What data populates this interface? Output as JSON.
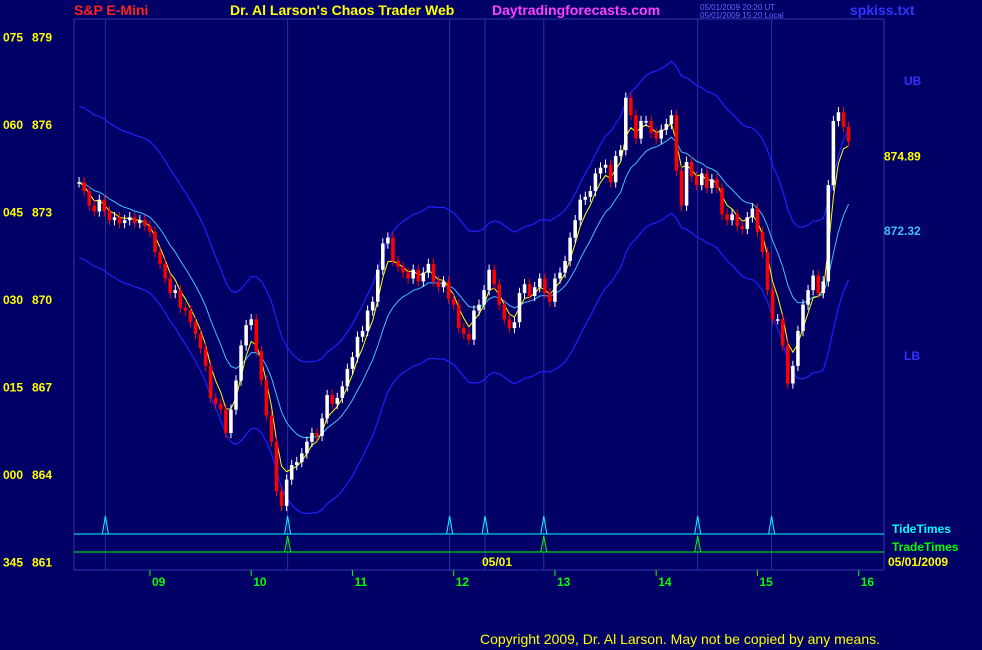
{
  "header": {
    "symbol": "S&P E-Mini",
    "title": "Dr. Al Larson's Chaos Trader Web",
    "site": "Daytradingforecasts.com",
    "stamp_ut": "05/01/2009 20:20 UT",
    "stamp_local": "05/01/2009 15:20 Local",
    "file": "spkiss.txt"
  },
  "labels": {
    "ub": "UB",
    "lb": "LB",
    "last_price": "874.89",
    "mid_price": "872.32",
    "tide_times": "TideTimes",
    "trade_times": "TradeTimes",
    "date_marker": "05/01",
    "date_right": "05/01/2009"
  },
  "copyright": "Copyright 2009, Dr. Al Larson. May not be copied by any means.",
  "colors": {
    "background": "#000066",
    "candle_up": "#ffffff",
    "candle_down": "#ff0000",
    "fast_ma": "#ffff00",
    "slow_ma": "#40c0ff",
    "bands": "#2020ff",
    "tide": "#00ffff",
    "trade": "#00ff00",
    "yaxis": "#ffff00",
    "xaxis": "#00ff00"
  },
  "chart_data": {
    "type": "candlestick",
    "y_ticks": [
      {
        "left": "075",
        "value": 879
      },
      {
        "left": "060",
        "value": 876
      },
      {
        "left": "045",
        "value": 873
      },
      {
        "left": "030",
        "value": 870
      },
      {
        "left": "015",
        "value": 867
      },
      {
        "left": "000",
        "value": 864
      },
      {
        "left": "345",
        "value": 861
      }
    ],
    "x_ticks": [
      "09",
      "10",
      "11",
      "12",
      "13",
      "14",
      "15",
      "16"
    ],
    "x_tick_times": [
      9,
      10,
      11,
      12,
      13,
      14,
      15,
      16
    ],
    "x_range": [
      8.25,
      16.25
    ],
    "ylim": [
      860.7,
      879.6
    ],
    "tide_times": [
      8.56,
      10.36,
      11.96,
      12.31,
      12.89,
      14.41,
      15.14
    ],
    "trade_times": [
      10.36,
      12.89,
      14.41
    ],
    "vlines": [
      8.56,
      10.36,
      11.96,
      12.31,
      12.89,
      14.41,
      15.14
    ],
    "last_price": 874.89,
    "mid_price": 872.32,
    "candles": {
      "start": 8.3,
      "step": 0.05,
      "closes": [
        874.0,
        873.7,
        873.2,
        873.0,
        873.4,
        873.0,
        872.7,
        872.8,
        872.6,
        872.7,
        872.8,
        872.6,
        872.7,
        872.5,
        872.3,
        871.6,
        871.2,
        870.7,
        870.2,
        870.3,
        869.7,
        869.6,
        869.2,
        868.8,
        868.3,
        867.7,
        866.6,
        866.4,
        866.2,
        865.4,
        866.2,
        867.2,
        868.4,
        869.1,
        869.3,
        868.2,
        867.2,
        866.0,
        865.1,
        863.4,
        862.9,
        863.8,
        864.3,
        864.4,
        864.7,
        865.1,
        865.4,
        865.3,
        865.9,
        866.7,
        866.4,
        866.6,
        867.0,
        867.6,
        868.0,
        868.7,
        868.9,
        869.6,
        869.9,
        871.0,
        871.9,
        872.1,
        871.3,
        871.1,
        870.9,
        870.7,
        871.0,
        870.6,
        870.9,
        871.2,
        870.6,
        870.4,
        870.6,
        870.0,
        869.8,
        869.0,
        868.8,
        868.6,
        869.6,
        869.8,
        870.3,
        871.0,
        870.5,
        869.8,
        869.3,
        869.0,
        869.2,
        870.2,
        870.5,
        870.1,
        870.4,
        870.7,
        870.2,
        869.9,
        870.7,
        870.9,
        871.3,
        872.1,
        872.7,
        873.4,
        873.5,
        873.7,
        874.3,
        874.5,
        874.6,
        874.0,
        874.9,
        875.1,
        876.9,
        876.3,
        875.5,
        876.1,
        876.1,
        875.7,
        875.5,
        875.8,
        876.0,
        876.3,
        874.4,
        873.2,
        874.7,
        874.2,
        873.9,
        874.3,
        873.8,
        874.1,
        873.8,
        872.9,
        872.7,
        872.9,
        872.5,
        872.4,
        872.8,
        873.1,
        872.3,
        871.6,
        870.3,
        869.3,
        869.3,
        868.4,
        867.1,
        867.7,
        868.9,
        869.8,
        870.3,
        870.8,
        870.2,
        870.6,
        873.9,
        876.1,
        876.4,
        875.9,
        875.4
      ]
    }
  }
}
